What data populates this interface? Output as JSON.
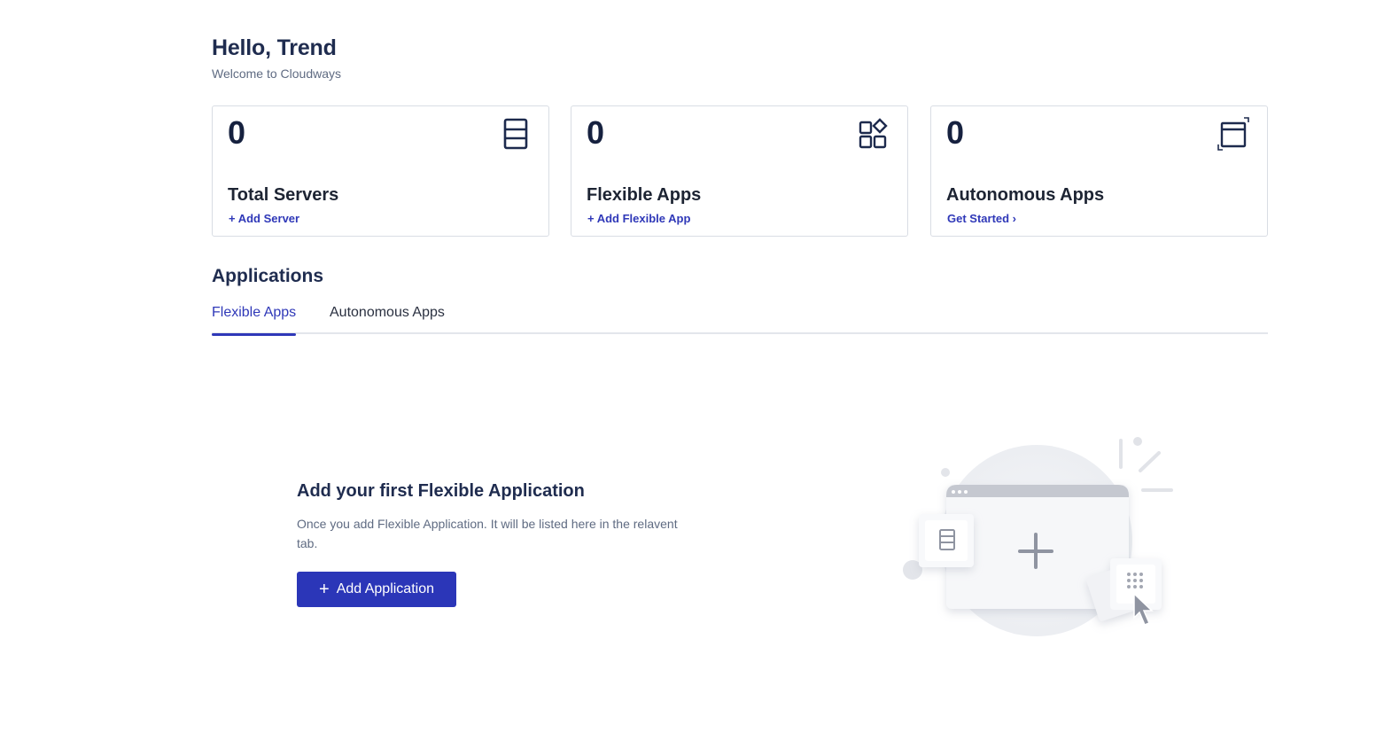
{
  "header": {
    "greeting": "Hello, Trend",
    "subtitle": "Welcome to Cloudways"
  },
  "cards": [
    {
      "count": "0",
      "title": "Total Servers",
      "link": "+ Add Server",
      "icon": "server-icon"
    },
    {
      "count": "0",
      "title": "Flexible Apps",
      "link": "+ Add Flexible App",
      "icon": "apps-grid-icon"
    },
    {
      "count": "0",
      "title": "Autonomous Apps",
      "link": "Get Started ›",
      "icon": "window-expand-icon"
    }
  ],
  "applications": {
    "title": "Applications",
    "tabs": [
      {
        "label": "Flexible Apps",
        "active": true
      },
      {
        "label": "Autonomous Apps",
        "active": false
      }
    ]
  },
  "empty_state": {
    "heading": "Add your first Flexible Application",
    "description": "Once you add Flexible Application. It will be listed here in the relavent tab.",
    "button_label": "Add Application",
    "button_icon": "+"
  },
  "colors": {
    "accent": "#2f38b8",
    "button": "#2b36b8",
    "heading": "#1f2c4f",
    "muted": "#5f6b82",
    "border": "#d9dde4"
  }
}
